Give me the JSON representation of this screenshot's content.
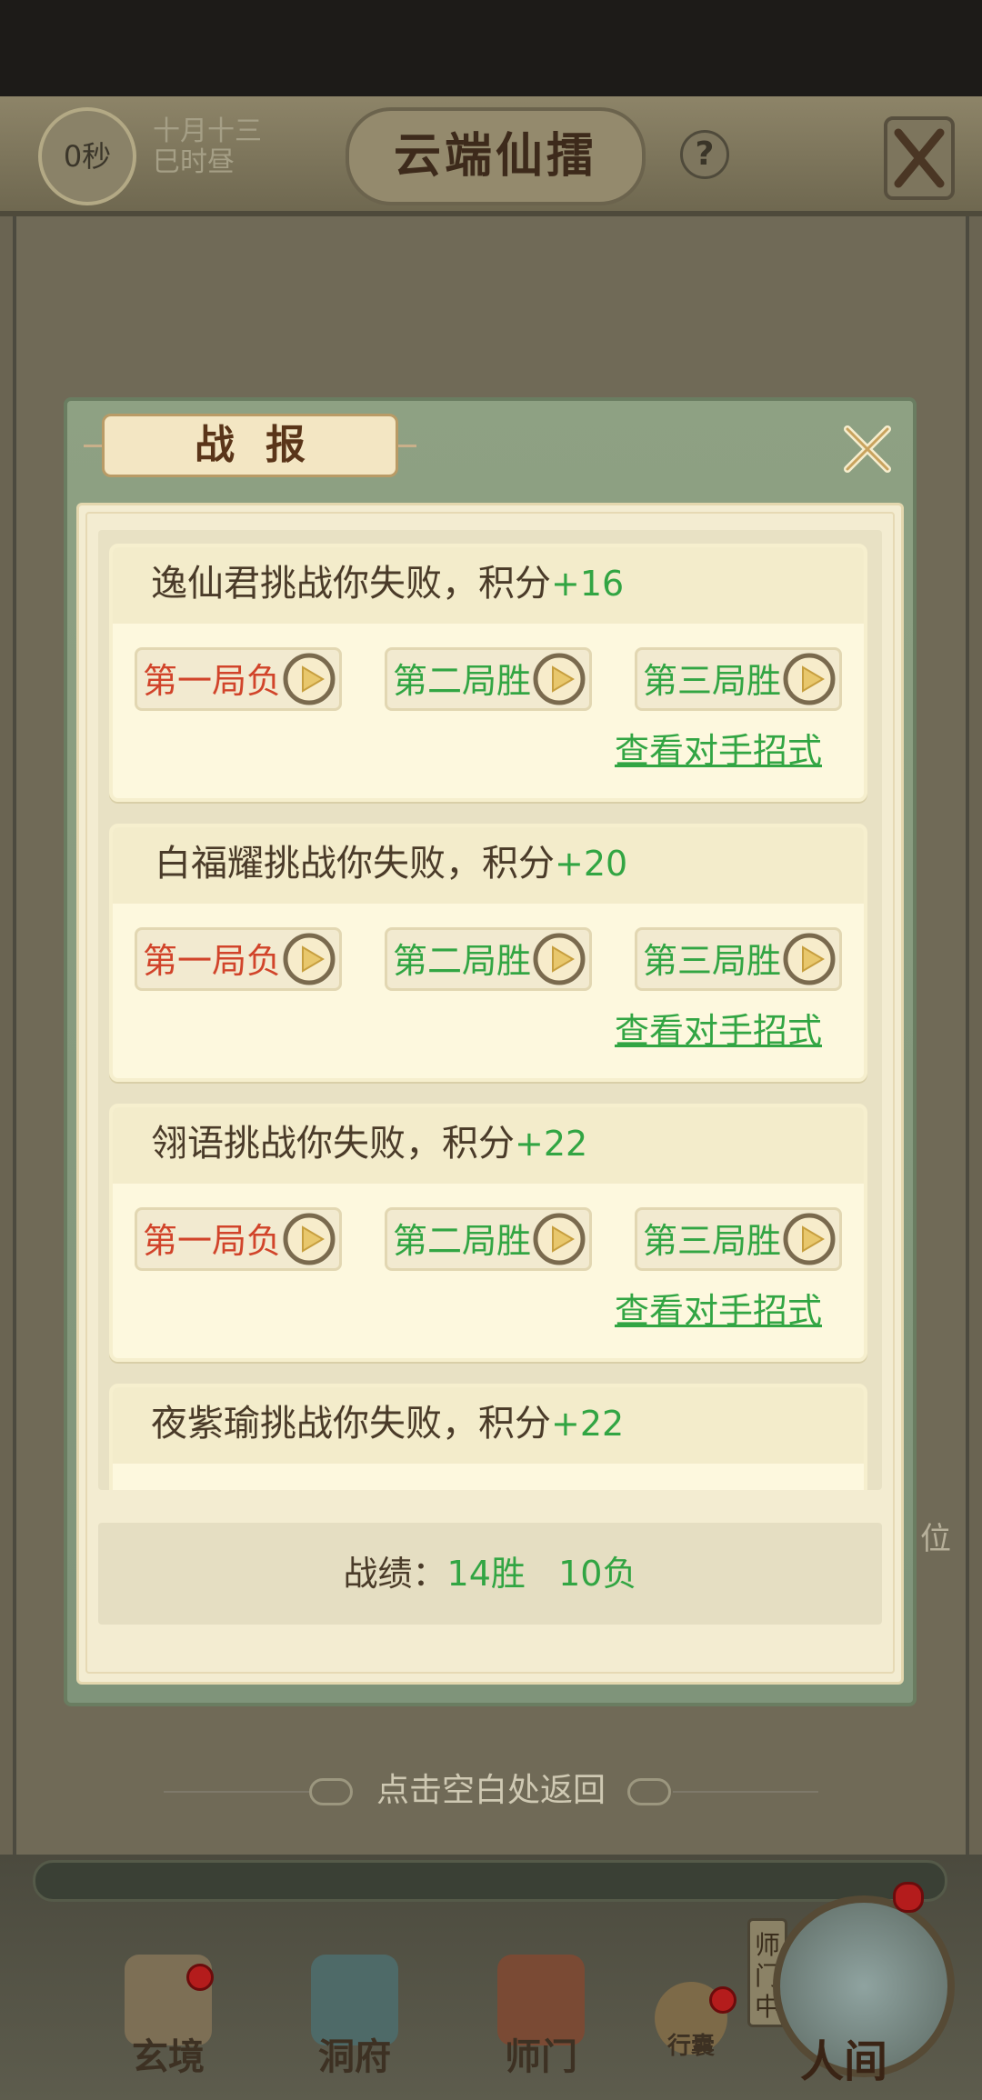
{
  "header": {
    "timer": "0秒",
    "date_line1": "十月十三",
    "date_line2": "巳时昼",
    "title": "云端仙擂",
    "help": "?"
  },
  "background": {
    "rank_label": "位"
  },
  "modal": {
    "title": "战报",
    "reports": [
      {
        "text": "逸仙君挑战你失败，积分",
        "points": "+16",
        "rounds": [
          {
            "label": "第一局负",
            "result": "lose"
          },
          {
            "label": "第二局胜",
            "result": "win"
          },
          {
            "label": "第三局胜",
            "result": "win"
          }
        ],
        "view_link": "查看对手招式"
      },
      {
        "text": "白福耀挑战你失败，积分",
        "points": "+20",
        "rounds": [
          {
            "label": "第一局负",
            "result": "lose"
          },
          {
            "label": "第二局胜",
            "result": "win"
          },
          {
            "label": "第三局胜",
            "result": "win"
          }
        ],
        "view_link": "查看对手招式"
      },
      {
        "text": "翎语挑战你失败，积分",
        "points": "+22",
        "rounds": [
          {
            "label": "第一局负",
            "result": "lose"
          },
          {
            "label": "第二局胜",
            "result": "win"
          },
          {
            "label": "第三局胜",
            "result": "win"
          }
        ],
        "view_link": "查看对手招式"
      },
      {
        "text": "夜紫瑜挑战你失败，积分",
        "points": "+22",
        "rounds": [],
        "view_link": ""
      }
    ],
    "record_label": "战绩：",
    "record_wins": "14胜",
    "record_losses": "10负"
  },
  "tap_return": "点击空白处返回",
  "bottom_nav": {
    "items": [
      "玄境",
      "洞府",
      "师门",
      "行囊"
    ],
    "shimen_tab": "师门中",
    "main": "人间"
  },
  "colors": {
    "win": "#32a543",
    "lose": "#d1442a",
    "text": "#4a3b29"
  }
}
